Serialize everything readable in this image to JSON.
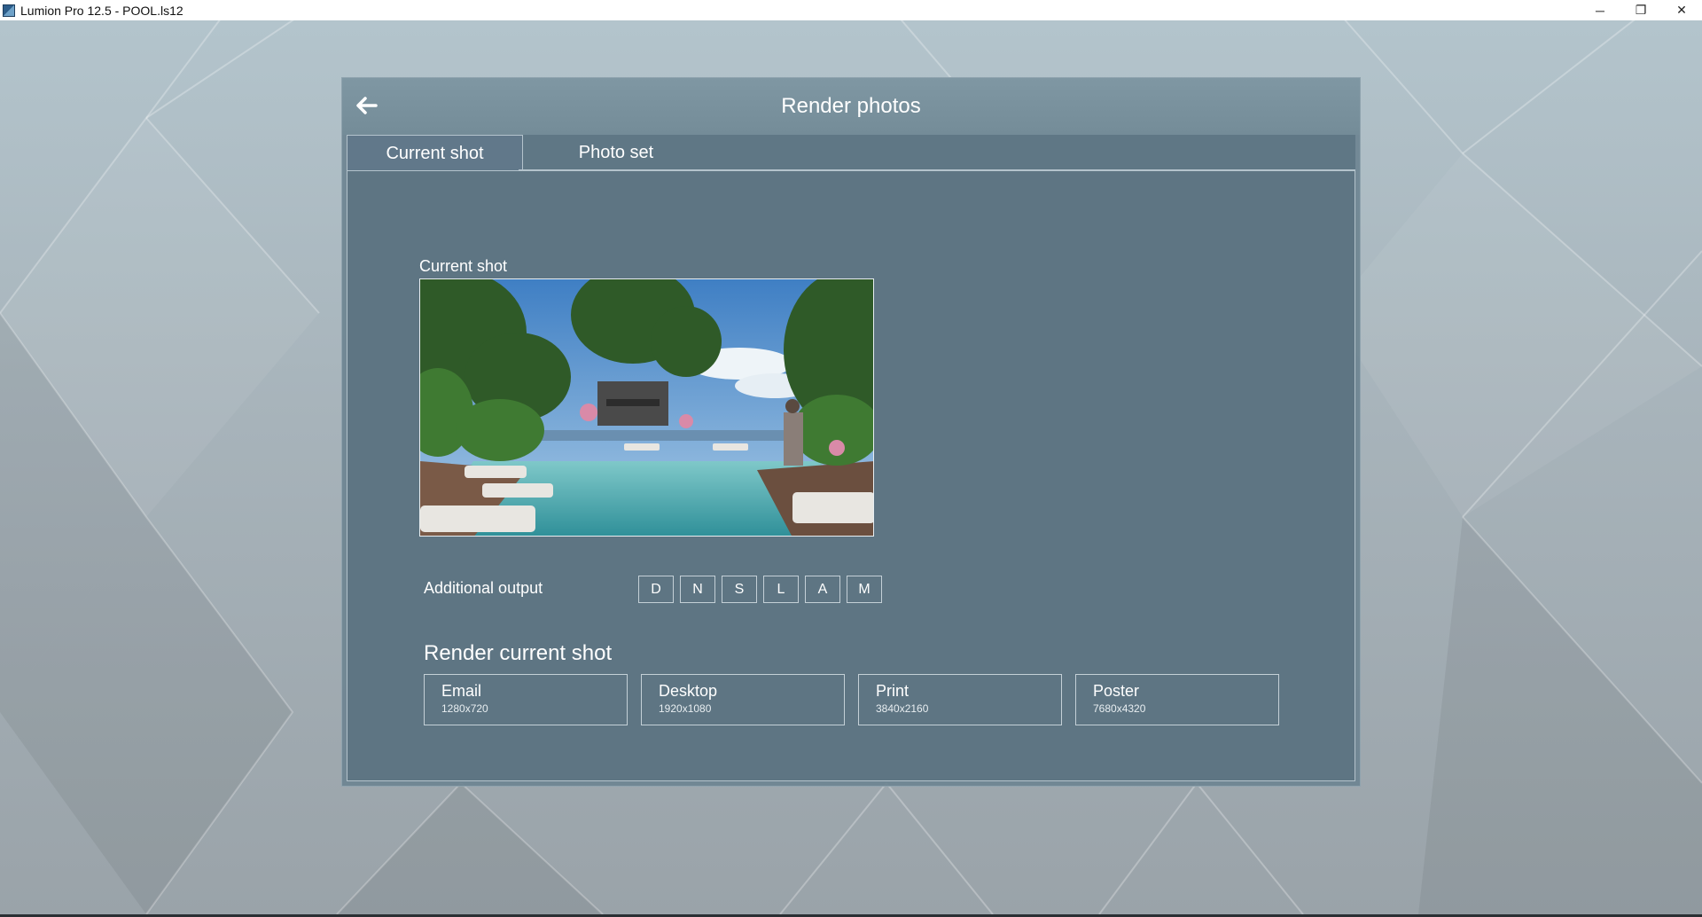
{
  "window": {
    "title": "Lumion Pro 12.5 - POOL.ls12",
    "minimize_glyph": "─",
    "restore_glyph": "❐",
    "close_glyph": "✕"
  },
  "dialog": {
    "title": "Render photos",
    "back_icon": "arrow-left-icon"
  },
  "tabs": [
    {
      "label": "Current shot",
      "active": true
    },
    {
      "label": "Photo set",
      "active": false
    }
  ],
  "preview": {
    "label": "Current shot"
  },
  "additional_output": {
    "label": "Additional output",
    "buttons": [
      "D",
      "N",
      "S",
      "L",
      "A",
      "M"
    ]
  },
  "render": {
    "heading": "Render current shot",
    "presets": [
      {
        "name": "Email",
        "resolution": "1280x720"
      },
      {
        "name": "Desktop",
        "resolution": "1920x1080"
      },
      {
        "name": "Print",
        "resolution": "3840x2160"
      },
      {
        "name": "Poster",
        "resolution": "7680x4320"
      }
    ]
  },
  "colors": {
    "dialog_bg": "#6e8491",
    "panel_bg": "#5e7583",
    "border": "#c4d0d7",
    "text": "#ffffff"
  }
}
